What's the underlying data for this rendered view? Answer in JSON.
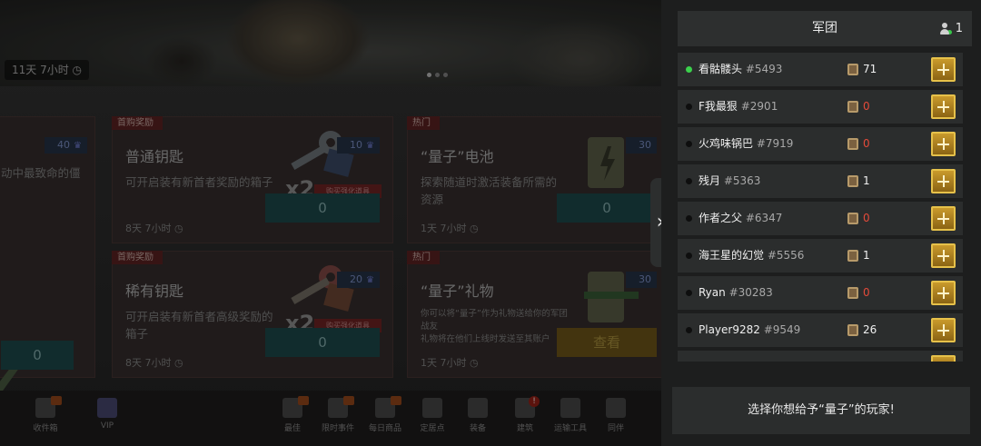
{
  "shop": {
    "banner_timer": "11天 7小时",
    "cards": [
      {
        "tag": "",
        "title": "",
        "desc": "动中最致命的僵",
        "count": "40",
        "price": "0",
        "timer": ""
      },
      {
        "tag": "首购奖励",
        "title": "普通钥匙",
        "desc": "可开启装有新首者奖励的箱子",
        "count": "10",
        "ribbon": "购买强化道具",
        "x2": "x2",
        "price": "0",
        "timer": "8天 7小时"
      },
      {
        "tag": "热门",
        "title": "“量子”电池",
        "desc": "探索随道时激活装备所需的资源",
        "count": "30",
        "price": "0",
        "timer": "1天 7小时"
      },
      {
        "tag": "首购奖励",
        "title": "稀有钥匙",
        "desc": "可开启装有新首者高级奖励的箱子",
        "count": "20",
        "ribbon": "购买强化道具",
        "x2": "x2",
        "price": "0",
        "timer": "8天 7小时"
      },
      {
        "tag": "热门",
        "title": "“量子”礼物",
        "desc": "你可以将“量子”作为礼物送给你的军团战友\n礼物将在他们上线时发送至其账户",
        "count": "30",
        "price": "查看",
        "timer": "1天 7小时"
      }
    ],
    "nav": [
      {
        "label": "收件箱",
        "icon": "mailbox-icon"
      },
      {
        "label": "VIP",
        "icon": "crown-icon"
      },
      {
        "label": "最佳",
        "icon": "thumbs-up-icon"
      },
      {
        "label": "限时事件",
        "icon": "badge-icon"
      },
      {
        "label": "每日商品",
        "icon": "flame-icon"
      },
      {
        "label": "定居点",
        "icon": "settlement-icon"
      },
      {
        "label": "装备",
        "icon": "gun-icon"
      },
      {
        "label": "建筑",
        "icon": "tools-icon"
      },
      {
        "label": "运输工具",
        "icon": "motorcycle-icon"
      },
      {
        "label": "同伴",
        "icon": "companion-icon"
      }
    ]
  },
  "panel": {
    "title": "军团",
    "online_count": "1",
    "players": [
      {
        "name": "看骷髅头",
        "id": "#5493",
        "qty": "71",
        "online": true
      },
      {
        "name": "F我最狠",
        "id": "#2901",
        "qty": "0",
        "online": false
      },
      {
        "name": "火鸡味锅巴",
        "id": "#7919",
        "qty": "0",
        "online": false
      },
      {
        "name": "残月",
        "id": "#5363",
        "qty": "1",
        "online": false
      },
      {
        "name": "作者之父",
        "id": "#6347",
        "qty": "0",
        "online": false
      },
      {
        "name": "海王星的幻觉",
        "id": "#5556",
        "qty": "1",
        "online": false
      },
      {
        "name": "Ryan",
        "id": "#30283",
        "qty": "0",
        "online": false
      },
      {
        "name": "Player9282",
        "id": "#9549",
        "qty": "26",
        "online": false
      }
    ],
    "hint": "选择你想给予“量子”的玩家!"
  },
  "colors": {
    "accent_gold": "#e6c14a",
    "online_green": "#3bd14c",
    "zero_red": "#e44a3a"
  }
}
